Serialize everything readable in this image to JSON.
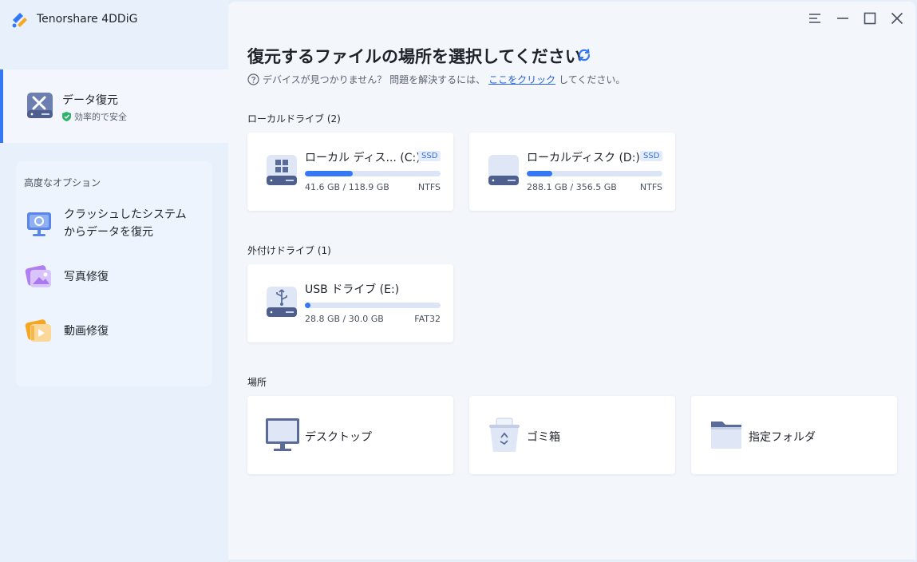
{
  "app": {
    "title": "Tenorshare 4DDiG"
  },
  "sidebar": {
    "active_item": {
      "label": "データ復元",
      "sub_label": "効率的で安全"
    },
    "advanced": {
      "title": "高度なオプション",
      "items": [
        {
          "label_line1": "クラッシュしたシステム",
          "label_line2": "からデータを復元"
        },
        {
          "label": "写真修復"
        },
        {
          "label": "動画修復"
        }
      ]
    }
  },
  "main": {
    "title": "復元するファイルの場所を選択してください",
    "help_prefix": "デバイスが見つかりません？ 問題を解決するには、",
    "help_link": "ここをクリック",
    "help_suffix": "してください。",
    "local_label": "ローカルドライブ (2)",
    "external_label": "外付けドライブ (1)",
    "locations_label": "場所",
    "drives": [
      {
        "name": "ローカル ディス... (C:)",
        "badge": "SSD",
        "size": "41.6 GB / 118.9 GB",
        "fs": "NTFS",
        "used_fraction": 0.35
      },
      {
        "name": "ローカルディスク (D:)",
        "badge": "SSD",
        "size": "288.1 GB / 356.5 GB",
        "fs": "NTFS",
        "used_fraction": 0.19
      },
      {
        "name": "USB ドライブ (E:)",
        "size": "28.8 GB / 30.0 GB",
        "fs": "FAT32",
        "used_fraction": 0.04
      }
    ],
    "locations": [
      {
        "label": "デスクトップ"
      },
      {
        "label": "ゴミ箱"
      },
      {
        "label": "指定フォルダ"
      }
    ]
  },
  "colors": {
    "accent": "#3478f6",
    "link": "#2a63d8",
    "safe_green": "#2fb36b"
  }
}
